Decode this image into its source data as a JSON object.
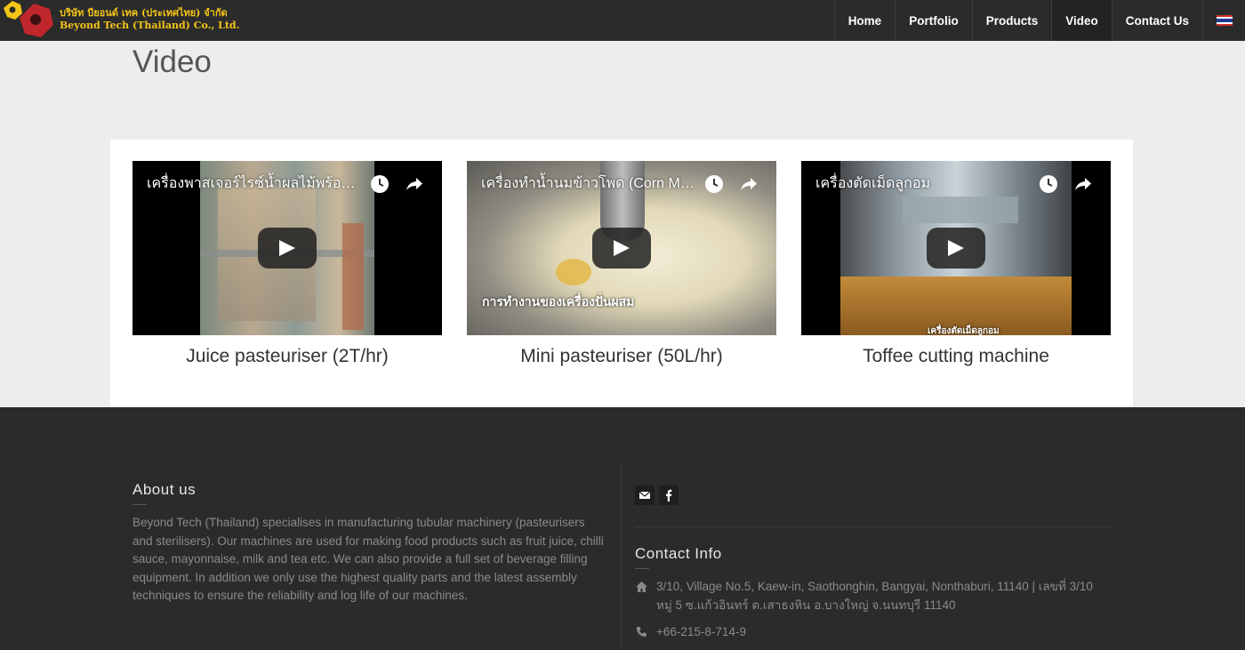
{
  "brand": {
    "name_thai": "บริษัท บียอนด์ เทค (ประเทศไทย) จำกัด",
    "name_en": "Beyond Tech (Thailand) Co., Ltd."
  },
  "nav": {
    "items": [
      {
        "label": "Home"
      },
      {
        "label": "Portfolio"
      },
      {
        "label": "Products"
      },
      {
        "label": "Video"
      },
      {
        "label": "Contact Us"
      }
    ],
    "active": "Video",
    "flag_icon": "thai-flag-icon"
  },
  "page": {
    "title": "Video"
  },
  "videos": [
    {
      "overlay_title": "เครื่องพาสเจอร์ไรซ์น้ำผลไม้พร้อมบรรจุ",
      "label": "Juice pasteuriser (2T/hr)",
      "caption": ""
    },
    {
      "overlay_title": "เครื่องทำน้ำนมข้าวโพด (Corn Milk)",
      "label": "Mini pasteuriser (50L/hr)",
      "caption": "การทำงานของเครื่องปั่นผสม"
    },
    {
      "overlay_title": "เครื่องตัดเม็ดลูกอม",
      "label": "Toffee cutting machine",
      "caption": "เครื่องตัดเม็ดลูกอม"
    }
  ],
  "footer": {
    "about_title": "About us",
    "about_text": "Beyond Tech (Thailand) specialises in manufacturing tubular machinery (pasteurisers and sterilisers). Our machines are used for making food products such as fruit juice, chilli sauce, mayonnaise, milk and tea etc. We can also provide a full set of beverage filling equipment. In addition we only use the highest quality parts and the latest assembly techniques to ensure the reliability and log life of our machines.",
    "contact_title": "Contact Info",
    "address": "3/10, Village No.5, Kaew-in, Saothonghin, Bangyai, Nonthaburi, 11140 | เลขที่ 3/10 หมู่ 5 ซ.แก้วอินทร์ ต.เสาธงหิน อ.บางใหญ่ จ.นนทบุรี 11140",
    "phone": "+66-215-8-714-9",
    "social": [
      "email-icon",
      "facebook-icon"
    ]
  },
  "colors": {
    "header_bg": "#2b2b2b",
    "brand_yellow": "#f5c518",
    "brand_red": "#c0272d",
    "page_bg": "#ededed",
    "footer_text": "#8a8a8a"
  }
}
